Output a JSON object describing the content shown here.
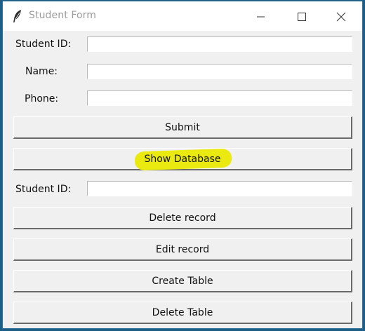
{
  "window": {
    "title": "Student Form",
    "controls": [
      "minimize-icon",
      "maximize-icon",
      "close-icon"
    ]
  },
  "form": {
    "student_id_label": "Student ID:",
    "student_id_value": "",
    "name_label": "Name:",
    "name_value": "",
    "phone_label": "Phone:",
    "phone_value": "",
    "submit_label": "Submit",
    "show_database_label": "Show Database",
    "delete_student_id_label": "Student ID:",
    "delete_student_id_value": "",
    "delete_record_label": "Delete record",
    "edit_record_label": "Edit record",
    "create_table_label": "Create Table",
    "delete_table_label": "Delete Table"
  },
  "colors": {
    "window_bg": "#f0f0f0",
    "desktop_bg": "#1d5f86",
    "highlight": "#eaea10",
    "title_text": "#9a9a9a"
  }
}
